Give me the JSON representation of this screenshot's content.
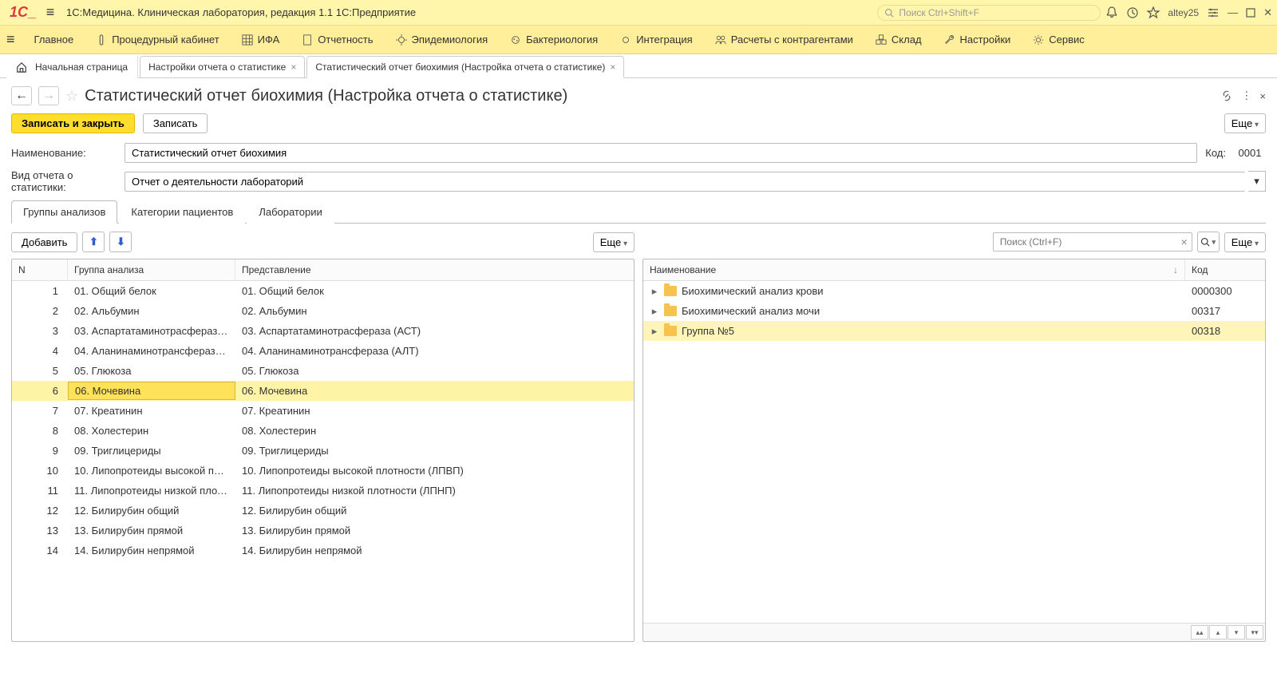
{
  "titlebar": {
    "app_title": "1С:Медицина. Клиническая лаборатория, редакция 1.1 1С:Предприятие",
    "search_placeholder": "Поиск Ctrl+Shift+F",
    "user": "altey25"
  },
  "menubar": {
    "main": "Главное",
    "procedure": "Процедурный кабинет",
    "ifa": "ИФА",
    "reports": "Отчетность",
    "epidemiology": "Эпидемиология",
    "bacteriology": "Бактериология",
    "integration": "Интеграция",
    "payments": "Расчеты с контрагентами",
    "warehouse": "Склад",
    "settings": "Настройки",
    "service": "Сервис"
  },
  "tabs": {
    "home": "Начальная страница",
    "settings": "Настройки отчета о статистике",
    "current": "Статистический отчет биохимия (Настройка отчета о статистике)"
  },
  "page": {
    "title": "Статистический отчет биохимия (Настройка отчета о статистике)",
    "save_close": "Записать и закрыть",
    "save": "Записать",
    "more": "Еще"
  },
  "form": {
    "name_label": "Наименование:",
    "name_value": "Статистический отчет биохимия",
    "code_label": "Код:",
    "code_value": "0001",
    "type_label": "Вид отчета о статистики:",
    "type_value": "Отчет о деятельности лабораторий"
  },
  "inner_tabs": {
    "groups": "Группы анализов",
    "categories": "Категории пациентов",
    "labs": "Лаборатории"
  },
  "left_panel": {
    "add": "Добавить",
    "more": "Еще",
    "col_n": "N",
    "col_group": "Группа анализа",
    "col_rep": "Представление",
    "rows": [
      {
        "n": "1",
        "group": "01. Общий белок",
        "rep": "01. Общий белок"
      },
      {
        "n": "2",
        "group": "02. Альбумин",
        "rep": "02. Альбумин"
      },
      {
        "n": "3",
        "group": "03. Аспартатаминотрасфераза (...",
        "rep": "03. Аспартатаминотрасфераза (АСТ)"
      },
      {
        "n": "4",
        "group": "04. Аланинаминотрансфераза (...",
        "rep": "04. Аланинаминотрансфераза (АЛТ)"
      },
      {
        "n": "5",
        "group": "05. Глюкоза",
        "rep": "05. Глюкоза"
      },
      {
        "n": "6",
        "group": "06. Мочевина",
        "rep": "06. Мочевина"
      },
      {
        "n": "7",
        "group": "07. Креатинин",
        "rep": "07. Креатинин"
      },
      {
        "n": "8",
        "group": "08. Холестерин",
        "rep": "08. Холестерин"
      },
      {
        "n": "9",
        "group": "09. Триглицериды",
        "rep": "09. Триглицериды"
      },
      {
        "n": "10",
        "group": "10. Липопротеиды высокой плот...",
        "rep": "10. Липопротеиды высокой плотности (ЛПВП)"
      },
      {
        "n": "11",
        "group": "11. Липопротеиды низкой плотно...",
        "rep": "11. Липопротеиды низкой плотности (ЛПНП)"
      },
      {
        "n": "12",
        "group": "12. Билирубин общий",
        "rep": "12. Билирубин общий"
      },
      {
        "n": "13",
        "group": "13. Билирубин прямой",
        "rep": "13. Билирубин прямой"
      },
      {
        "n": "14",
        "group": "14. Билирубин непрямой",
        "rep": "14. Билирубин непрямой"
      }
    ],
    "selected_index": 5
  },
  "right_panel": {
    "search_placeholder": "Поиск (Ctrl+F)",
    "more": "Еще",
    "col_name": "Наименование",
    "col_code": "Код",
    "rows": [
      {
        "name": "Биохимический анализ крови",
        "code": "0000300"
      },
      {
        "name": "Биохимический анализ мочи",
        "code": "00317"
      },
      {
        "name": "Группа №5",
        "code": "00318"
      }
    ],
    "highlighted_index": 2
  }
}
